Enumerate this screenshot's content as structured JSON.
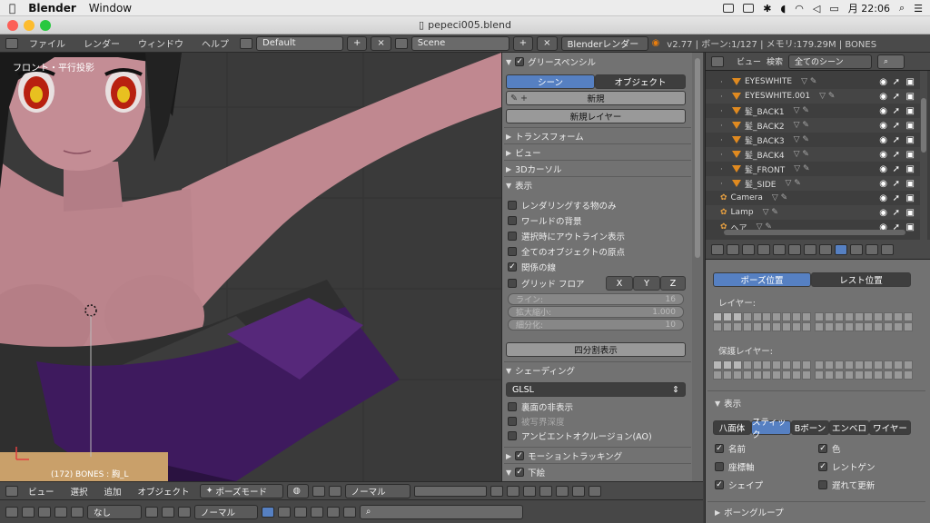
{
  "menubar": {
    "app": "Blender",
    "window": "Window",
    "time": "月 22:06"
  },
  "titlebar": {
    "title": "pepeci005.blend"
  },
  "info": {
    "menus": [
      "ファイル",
      "レンダー",
      "ウィンドウ",
      "ヘルプ"
    ],
    "layout": "Default",
    "scene": "Scene",
    "engine": "Blenderレンダー",
    "stats": "v2.77 | ボーン:1/127 | メモリ:179.29M | BONES"
  },
  "viewport": {
    "label": "フロント・平行投影",
    "object": "(172) BONES : 胸_L"
  },
  "tool": {
    "grease": "グリースペンシル",
    "scene_btn": "シーン",
    "object_btn": "オブジェクト",
    "new_btn": "新規",
    "new_layer": "新規レイヤー",
    "transform": "トランスフォーム",
    "view": "ビュー",
    "cursor": "3Dカーソル",
    "display": "表示",
    "opts": [
      "レンダリングする物のみ",
      "ワールドの背景",
      "選択時にアウトライン表示",
      "全てのオブジェクトの原点",
      "関係の線"
    ],
    "grid": "グリッド フロア",
    "x": "X",
    "y": "Y",
    "z": "Z",
    "lines_l": "ライン:",
    "lines_v": "16",
    "scale_l": "拡大縮小:",
    "scale_v": "1.000",
    "sub_l": "細分化:",
    "sub_v": "10",
    "quad": "四分割表示",
    "shading": "シェーディング",
    "glsl": "GLSL",
    "sh_opts": [
      "裏面の非表示",
      "被写界深度",
      "アンビエントオクルージョン(AO)"
    ],
    "motion": "モーショントラッキング",
    "bg": "下絵"
  },
  "outliner": {
    "view": "ビュー",
    "search": "検索",
    "filter": "全てのシーン",
    "items": [
      "EYESWHITE",
      "EYESWHITE.001",
      "髪_BACK1",
      "髪_BACK2",
      "髪_BACK3",
      "髪_BACK4",
      "髪_FRONT",
      "髪_SIDE",
      "Camera",
      "Lamp",
      "ヘア"
    ]
  },
  "bone": {
    "pose": "ポーズ位置",
    "rest": "レスト位置",
    "layers": "レイヤー:",
    "protect": "保護レイヤー:",
    "display": "表示",
    "tabs": [
      "八面体",
      "スティック",
      "Bボーン",
      "エンベロ",
      "ワイヤー"
    ],
    "opts": [
      "名前",
      "色",
      "座標軸",
      "レントゲン",
      "シェイプ",
      "遅れて更新"
    ],
    "group": "ボーングループ"
  },
  "vphdr": {
    "menus": [
      "ビュー",
      "選択",
      "追加",
      "オブジェクト"
    ],
    "mode": "ポーズモード",
    "pivot": "ノーマル"
  },
  "timeline": {
    "none": "なし",
    "normal": "ノーマル"
  },
  "colors": {
    "skin": "#c28b92",
    "purple": "#3e1a5e",
    "hair": "#1a1a1a",
    "accent": "#5680c2"
  }
}
